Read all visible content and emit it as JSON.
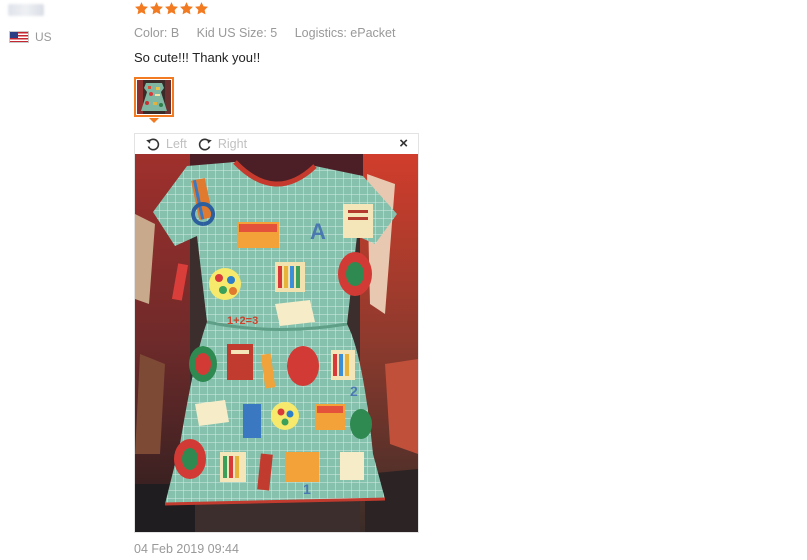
{
  "user": {
    "country": "US",
    "flag_icon": "us-flag-icon"
  },
  "review": {
    "rating": 5,
    "rating_max": 5,
    "star_color": "#f27a21",
    "attributes": {
      "color": "Color: B",
      "size": "Kid US Size: 5",
      "logistics": "Logistics: ePacket"
    },
    "text": "So cute!!! Thank you!!",
    "date": "04 Feb 2019 09:44"
  },
  "viewer": {
    "rotate_left_label": "Left",
    "rotate_right_label": "Right",
    "close_label": "×",
    "accent_color": "#f27a21"
  }
}
